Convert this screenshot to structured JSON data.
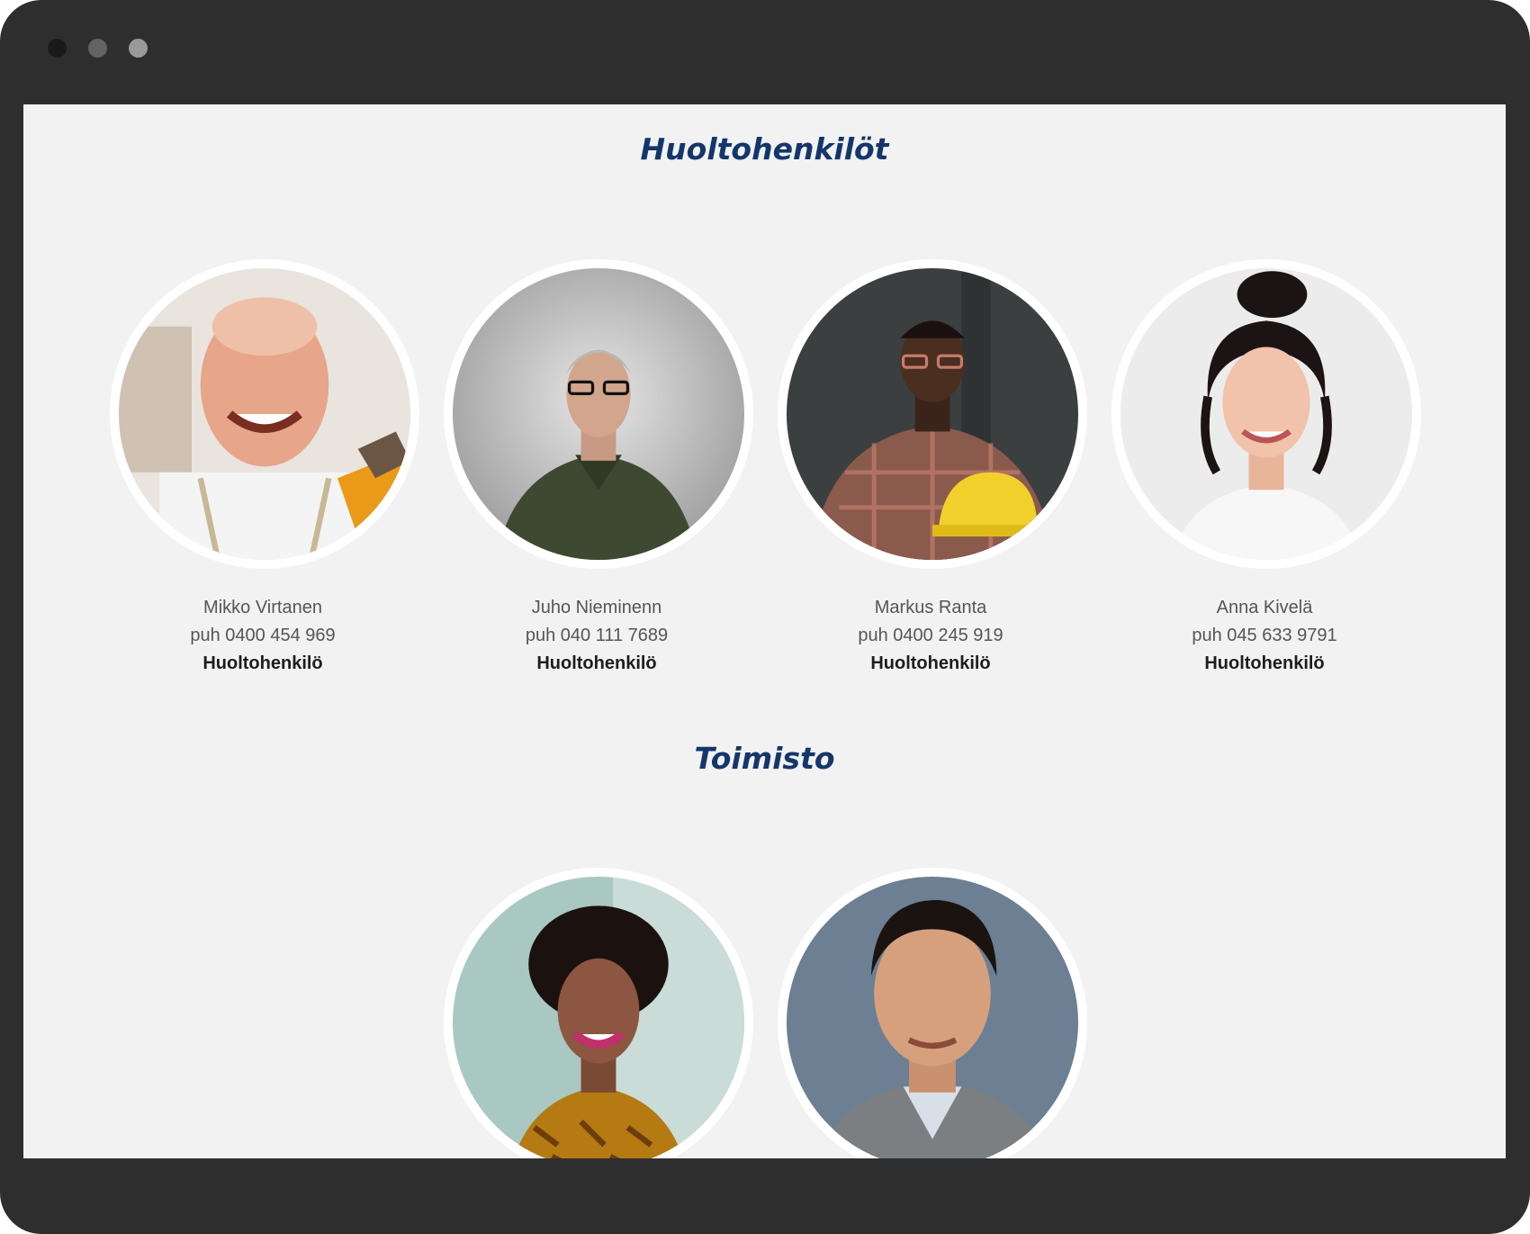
{
  "sections": [
    {
      "title": "Huoltohenkilöt",
      "people": [
        {
          "name": "Mikko Virtanen",
          "phone": "puh 0400 454 969",
          "role": "Huoltohenkilö"
        },
        {
          "name": "Juho Nieminenn",
          "phone": "puh 040 111 7689",
          "role": "Huoltohenkilö"
        },
        {
          "name": "Markus Ranta",
          "phone": "puh 0400 245 919",
          "role": "Huoltohenkilö"
        },
        {
          "name": "Anna Kivelä",
          "phone": "puh 045 633 9791",
          "role": "Huoltohenkilö"
        }
      ]
    },
    {
      "title": "Toimisto",
      "people": []
    }
  ],
  "colors": {
    "title": "#14366b",
    "page_bg": "#f2f2f2",
    "frame": "#2e2e2e",
    "avatar_border": "#ffffff"
  }
}
